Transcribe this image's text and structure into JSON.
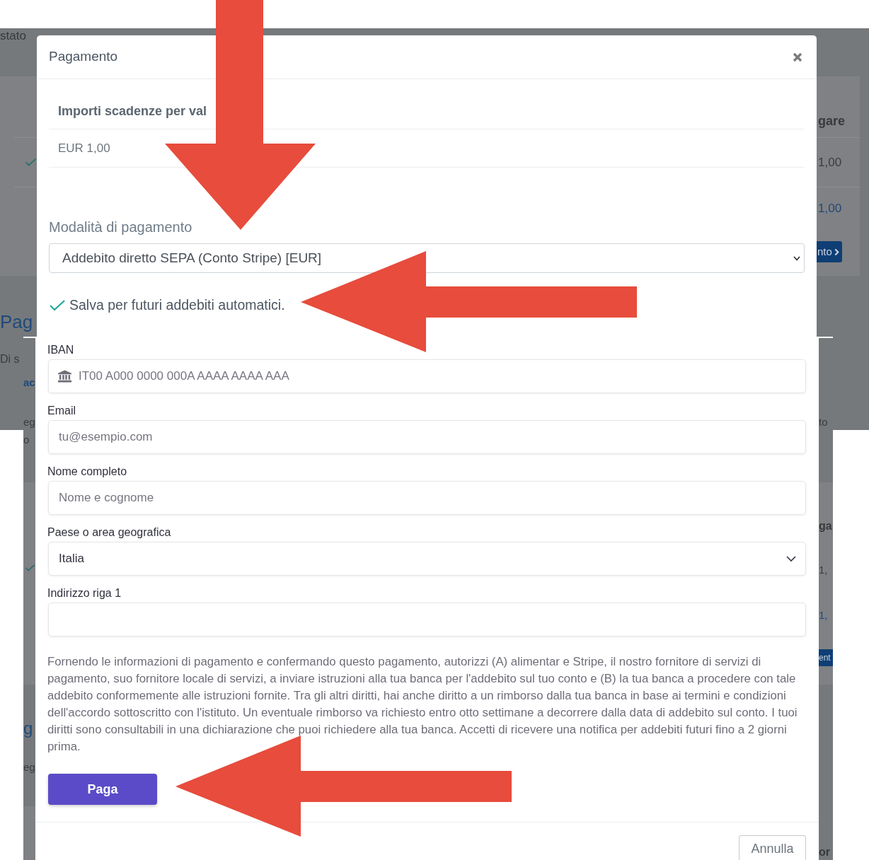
{
  "top_screen": {
    "background": {
      "notice": [
        "stato"
      ],
      "left_strip": {
        "heading": "Pag",
        "text": "Di s"
      },
      "right_card": {
        "heading": "gare",
        "rows": [
          {
            "amount": "1,00",
            "kind": "plain"
          },
          {
            "amount": "1,00",
            "kind": "link"
          }
        ],
        "button": "nto"
      }
    },
    "modal": {
      "title": "Pagamento",
      "summary_table": {
        "heading": "Importi scadenze per val",
        "rows": [
          "EUR 1,00"
        ]
      },
      "payment_method": {
        "label": "Modalità di pagamento",
        "value": "Addebito diretto SEPA (Conto Stripe) [EUR]"
      },
      "save_option": {
        "label": "Salva per futuri addebiti automatici.",
        "checked": true
      }
    }
  },
  "bottom_screen": {
    "background": {
      "left_strip": {
        "link": "ac",
        "lines": [
          "eg",
          "o"
        ],
        "heading": "g",
        "text": "eg"
      },
      "right_strip": {
        "text": "to",
        "heading": "ga",
        "rows": [
          {
            "amount": "1,",
            "kind": "plain"
          },
          {
            "amount": "1,",
            "kind": "link"
          }
        ],
        "button": "ent",
        "footer": "or"
      }
    },
    "modal": {
      "fields": [
        {
          "kind": "iban",
          "label": "IBAN",
          "placeholder": "IT00 A000 0000 000A AAAA AAAA AAA"
        },
        {
          "kind": "text",
          "label": "Email",
          "placeholder": "tu@esempio.com"
        },
        {
          "kind": "text",
          "label": "Nome completo",
          "placeholder": "Nome e cognome"
        },
        {
          "kind": "select",
          "label": "Paese o area geografica",
          "value": "Italia"
        },
        {
          "kind": "text",
          "label": "Indirizzo riga 1"
        }
      ],
      "mandate_text": "Fornendo le informazioni di pagamento e confermando questo pagamento, autorizzi (A) alimentar e Stripe, il nostro fornitore di servizi di pagamento, suo fornitore locale di servizi, a inviare istruzioni alla tua banca per l'addebito sul tuo conto e (B) la tua banca a procedere con tale addebito conformemente alle istruzioni fornite. Tra gli altri diritti, hai anche diritto a un rimborso dalla tua banca in base ai termini e condizioni dell'accordo sottoscritto con l'istituto. Un eventuale rimborso va richiesto entro otto settimane a decorrere dalla data di addebito sul conto. I tuoi diritti sono consultabili in una dichiarazione che puoi richiedere alla tua banca. Accetti di ricevere una notifica per addebiti futuri fino a 2 giorni prima.",
      "pay_button": "Paga",
      "cancel_button": "Annulla"
    }
  },
  "annotations": [
    {
      "kind": "down_arrow"
    },
    {
      "kind": "left_arrow"
    },
    {
      "kind": "left_arrow"
    }
  ]
}
